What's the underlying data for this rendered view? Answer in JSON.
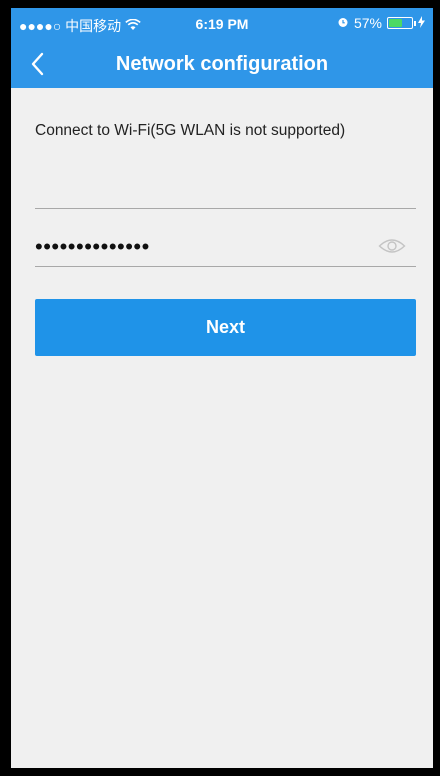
{
  "status_bar": {
    "carrier": "●●●●○ 中国移动",
    "wifi_icon": "wifi-icon",
    "time": "6:19 PM",
    "alarm_icon": "alarm-icon",
    "battery_percent": "57%",
    "battery_level": 0.57,
    "charging_icon": "charging-icon"
  },
  "nav": {
    "back_icon": "back-chevron-icon",
    "title": "Network configuration"
  },
  "form": {
    "intro": "Connect to Wi-Fi(5G WLAN is not supported)",
    "ssid_value": "",
    "password_value": "••••••••••••••",
    "eye_icon": "eye-icon",
    "next_label": "Next"
  },
  "colors": {
    "accent": "#2f96e8",
    "button": "#1f93e8",
    "background": "#f0f0f0"
  }
}
